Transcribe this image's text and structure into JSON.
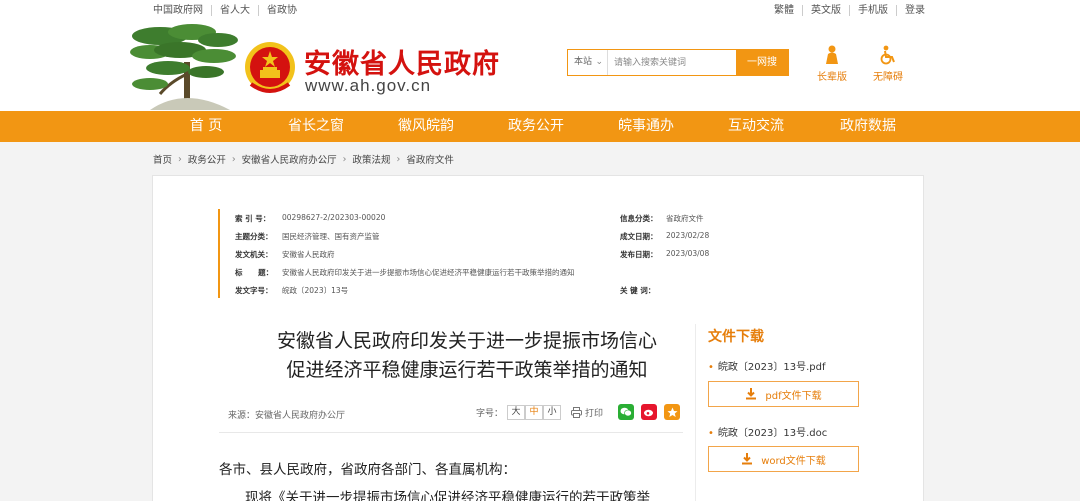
{
  "topbar": {
    "left_links": [
      "中国政府网",
      "省人大",
      "省政协"
    ],
    "right_links": [
      "繁體",
      "英文版",
      "手机版",
      "登录"
    ]
  },
  "header": {
    "site_title": "安徽省人民政府",
    "domain": "www.ah.gov.cn",
    "search_scope": "本站",
    "search_placeholder": "请输入搜索关键词",
    "search_button": "一网搜",
    "tool_elder": "长辈版",
    "tool_access": "无障碍"
  },
  "nav": [
    "首 页",
    "省长之窗",
    "徽风皖韵",
    "政务公开",
    "皖事通办",
    "互动交流",
    "政府数据"
  ],
  "breadcrumb": [
    "首页",
    "政务公开",
    "安徽省人民政府办公厅",
    "政策法规",
    "省政府文件"
  ],
  "meta": {
    "index_label": "索 引 号：",
    "index_value": "00298627-2/202303-00020",
    "category_label": "信息分类：",
    "category_value": "省政府文件",
    "topic_label": "主题分类：",
    "topic_value": "国民经济管理、国有资产监管",
    "created_label": "成文日期：",
    "created_value": "2023/02/28",
    "issuer_label": "发文机关：",
    "issuer_value": "安徽省人民政府",
    "published_label": "发布日期：",
    "published_value": "2023/03/08",
    "title_label": "标      题：",
    "title_value": "安徽省人民政府印发关于进一步提振市场信心促进经济平稳健康运行若干政策举措的通知",
    "docno_label": "发文字号：",
    "docno_value": "皖政〔2023〕13号",
    "keywords_label": "关 键 词："
  },
  "article": {
    "title_line1": "安徽省人民政府印发关于进一步提振市场信心",
    "title_line2": "促进经济平稳健康运行若干政策举措的通知",
    "source": "来源：安徽省人民政府办公厅",
    "font_label": "字号：",
    "font_sizes": [
      "大",
      "中",
      "小"
    ],
    "print_label": "打印",
    "salutation": "各市、县人民政府，省政府各部门、各直属机构：",
    "body_start": "现将《关于进一步提振市场信心促进经济平稳健康运行的若干政策举"
  },
  "downloads": {
    "heading": "文件下载",
    "files": [
      {
        "name": "皖政〔2023〕13号.pdf",
        "button": "pdf文件下载"
      },
      {
        "name": "皖政〔2023〕13号.doc",
        "button": "word文件下载"
      }
    ]
  },
  "colors": {
    "brand_orange": "#f29613",
    "title_red": "#d4120f",
    "wechat_green": "#2aae34",
    "weibo_red": "#e6162d",
    "star_orange": "#f29613"
  },
  "icons": [
    "pine-tree-logo",
    "national-emblem",
    "chevron-down-icon",
    "elder-icon",
    "wheelchair-icon",
    "printer-icon",
    "wechat-icon",
    "weibo-icon",
    "star-icon",
    "download-icon"
  ]
}
